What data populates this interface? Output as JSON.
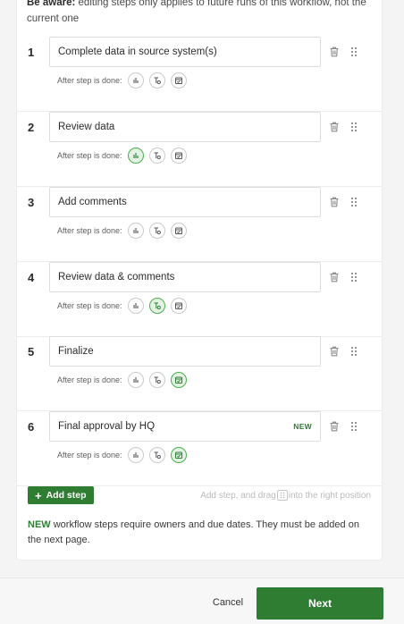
{
  "notice": {
    "bold": "Be aware:",
    "text": " editing steps only applies to future runs of this workflow, not the current one"
  },
  "after_label": "After step is done:",
  "icons": {
    "option_1": "bar-chart-icon",
    "option_2": "text-check-icon",
    "option_3": "calendar-check-icon",
    "delete": "trash-icon",
    "reorder": "drag-handle-icon"
  },
  "colors": {
    "accent": "#2e7d32",
    "active_bg": "#e3f2e4",
    "active_border": "#4caf50"
  },
  "steps": [
    {
      "number": "1",
      "title": "Complete data in source system(s)",
      "tag": "",
      "active_option": 0
    },
    {
      "number": "2",
      "title": "Review data",
      "tag": "",
      "active_option": 1
    },
    {
      "number": "3",
      "title": "Add comments",
      "tag": "",
      "active_option": 0
    },
    {
      "number": "4",
      "title": "Review data & comments",
      "tag": "",
      "active_option": 2
    },
    {
      "number": "5",
      "title": "Finalize",
      "tag": "",
      "active_option": 3
    },
    {
      "number": "6",
      "title": "Final approval by HQ",
      "tag": "NEW",
      "active_option": 3
    }
  ],
  "add_step": {
    "label": "Add step",
    "hint_before": "Add step, and drag",
    "hint_after": "into the right position"
  },
  "footer_note": {
    "new": "NEW",
    "text": " workflow steps require owners and due dates. They must be added on the next page."
  },
  "actions": {
    "cancel": "Cancel",
    "next": "Next"
  }
}
